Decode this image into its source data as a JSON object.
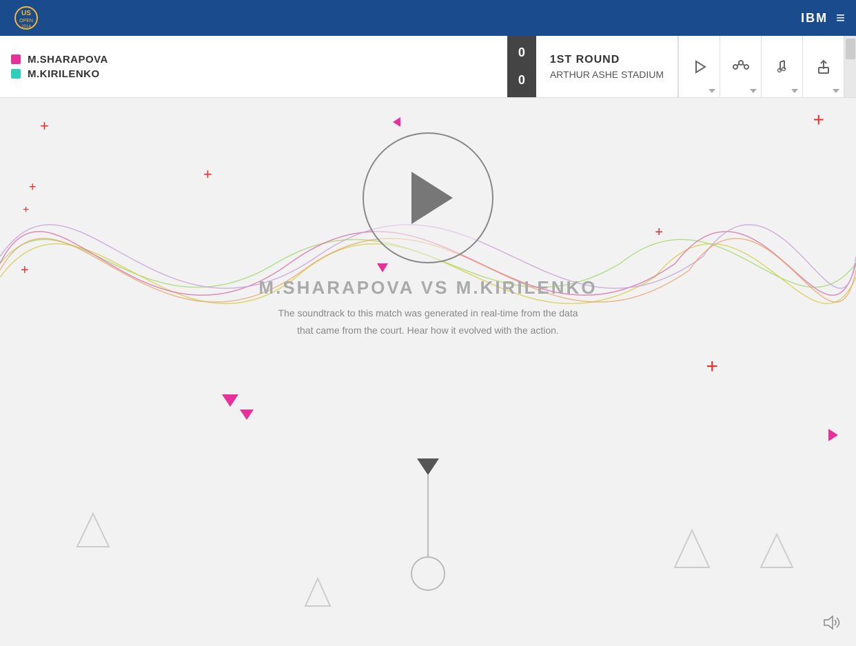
{
  "header": {
    "logo_alt": "US Open 2014",
    "ibm_label": "IBM",
    "menu_icon": "≡"
  },
  "scoreboard": {
    "player1": {
      "name": "M.SHARAPOVA",
      "color": "#e8309a",
      "score": "0"
    },
    "player2": {
      "name": "M.KIRILENKO",
      "color": "#2ecfb8",
      "score": "0"
    },
    "round": "1ST ROUND",
    "venue": "ARTHUR ASHE STADIUM"
  },
  "toolbar": {
    "play_label": "▶",
    "path_label": "⋯",
    "music_label": "♪",
    "share_label": "⬆"
  },
  "main": {
    "match_title": "M.SHARAPOVA VS M.KIRILENKO",
    "description_line1": "The soundtrack to this match was generated in real-time from the data",
    "description_line2": "that came from the court. Hear how it evolved with the action."
  },
  "volume": {
    "icon": "🔊"
  }
}
